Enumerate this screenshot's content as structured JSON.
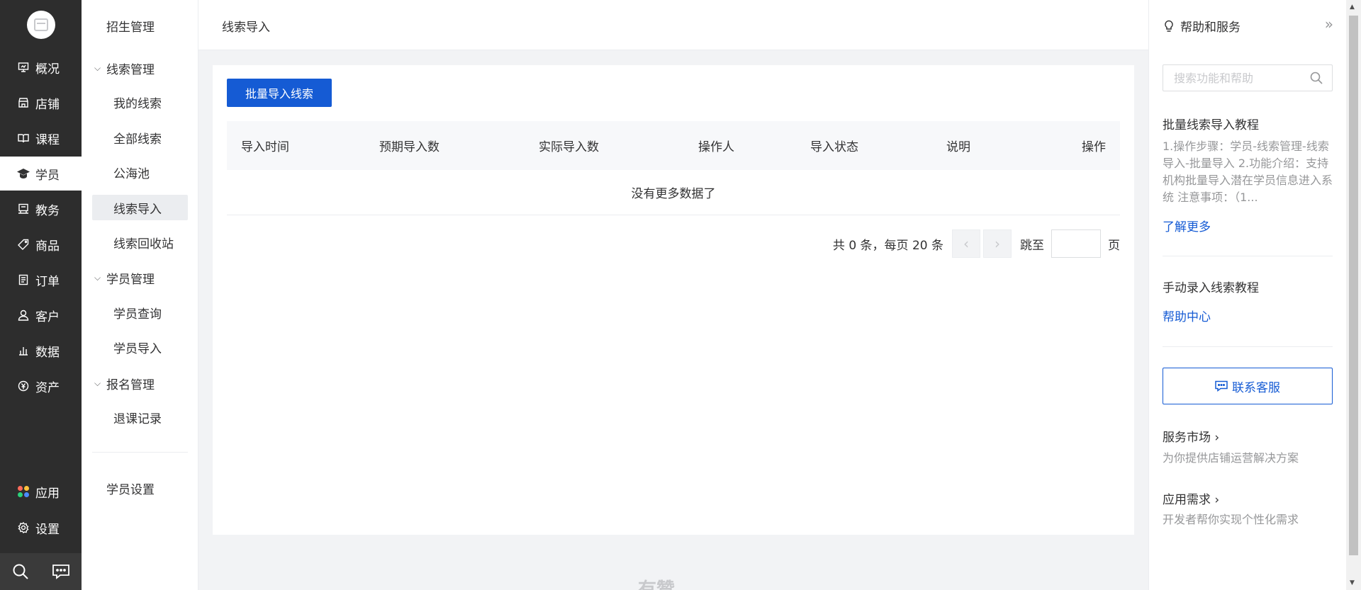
{
  "nav": {
    "items": [
      {
        "label": "概况",
        "icon": "dashboard-icon"
      },
      {
        "label": "店铺",
        "icon": "store-icon"
      },
      {
        "label": "课程",
        "icon": "book-icon"
      },
      {
        "label": "学员",
        "icon": "graduation-cap-icon",
        "active": true
      },
      {
        "label": "教务",
        "icon": "teaching-icon"
      },
      {
        "label": "商品",
        "icon": "tag-icon"
      },
      {
        "label": "订单",
        "icon": "order-icon"
      },
      {
        "label": "客户",
        "icon": "user-icon"
      },
      {
        "label": "数据",
        "icon": "chart-icon"
      },
      {
        "label": "资产",
        "icon": "yuan-icon"
      }
    ],
    "apps_label": "应用",
    "settings_label": "设置"
  },
  "subnav": {
    "title": "招生管理",
    "groups": [
      {
        "label": "线索管理",
        "items": [
          "我的线索",
          "全部线索",
          "公海池",
          "线索导入",
          "线索回收站"
        ]
      },
      {
        "label": "学员管理",
        "items": [
          "学员查询",
          "学员导入"
        ]
      },
      {
        "label": "报名管理",
        "items": [
          "退课记录"
        ]
      }
    ],
    "active_item": "线索导入",
    "settings_label": "学员设置"
  },
  "header": {
    "breadcrumb": "线索导入"
  },
  "main": {
    "import_button": "批量导入线索",
    "columns": [
      "导入时间",
      "预期导入数",
      "实际导入数",
      "操作人",
      "导入状态",
      "说明",
      "操作"
    ],
    "empty_text": "没有更多数据了",
    "pagination": {
      "summary": "共 0 条，每页 20 条",
      "jump_label": "跳至",
      "page_label": "页"
    },
    "watermark": "有赞"
  },
  "help": {
    "title": "帮助和服务",
    "search_placeholder": "搜索功能和帮助",
    "section1_title": "批量线索导入教程",
    "section1_desc": "1.操作步骤：学员-线索管理-线索导入-批量导入 2.功能介绍：支持机构批量导入潜在学员信息进入系统 注意事项：（1...",
    "section1_link": "了解更多",
    "section2_title": "手动录入线索教程",
    "section2_link": "帮助中心",
    "contact_button": "联系客服",
    "market_title": "服务市场",
    "market_desc": "为你提供店铺运营解决方案",
    "demand_title": "应用需求",
    "demand_desc": "开发者帮你实现个性化需求"
  },
  "colors": {
    "primary": "#155bd4",
    "nav_bg": "#2d2d2d",
    "text": "#323233",
    "muted": "#969799"
  }
}
